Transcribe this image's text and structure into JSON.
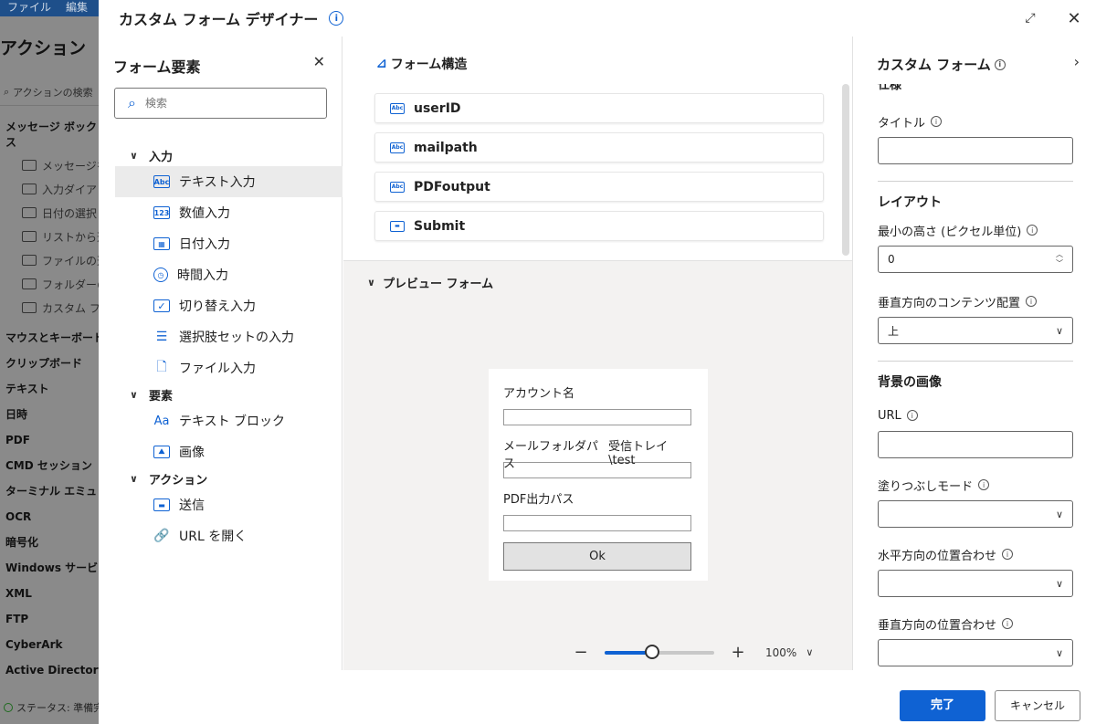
{
  "bg_app": {
    "menu": [
      "ファイル",
      "編集"
    ],
    "title": "アクション",
    "search_placeholder": "アクションの検索",
    "group": "メッセージ ボックス",
    "sub_items": [
      "メッセージを",
      "入力ダイア",
      "日付の選択",
      "リストから選",
      "ファイルの選",
      "フォルダーの",
      "カスタム フォ"
    ],
    "categories": [
      "マウスとキーボード",
      "クリップボード",
      "テキスト",
      "日時",
      "PDF",
      "CMD セッション",
      "ターミナル エミュレーシ",
      "OCR",
      "暗号化",
      "Windows サービス",
      "XML",
      "FTP",
      "CyberArk",
      "Active Directory"
    ],
    "status": "ステータス: 準備完了"
  },
  "dialog": {
    "title": "カスタム フォーム デザイナー",
    "expand_icon": "expand-icon",
    "close_icon": "close-icon"
  },
  "left_pane": {
    "title": "フォーム要素",
    "search_placeholder": "検索",
    "groups": [
      {
        "label": "入力",
        "items": [
          "テキスト入力",
          "数値入力",
          "日付入力",
          "時間入力",
          "切り替え入力",
          "選択肢セットの入力",
          "ファイル入力"
        ]
      },
      {
        "label": "要素",
        "items": [
          "テキスト ブロック",
          "画像"
        ]
      },
      {
        "label": "アクション",
        "items": [
          "送信",
          "URL を開く"
        ]
      }
    ],
    "selected": "テキスト入力"
  },
  "structure": {
    "title": "フォーム構造",
    "rows": [
      "userID",
      "mailpath",
      "PDFoutput",
      "Submit"
    ]
  },
  "preview": {
    "title": "プレビュー フォーム",
    "fields": [
      {
        "label": "アカウント名",
        "extra": ""
      },
      {
        "label": "メールフォルダパス",
        "extra": "受信トレイ\\test"
      },
      {
        "label": "PDF出力パス",
        "extra": ""
      }
    ],
    "button": "Ok",
    "zoom": "100%",
    "zoom_fraction": 0.43
  },
  "right_pane": {
    "title": "カスタム フォーム",
    "cut_section": "仕様",
    "title_label": "タイトル",
    "layout_section": "レイアウト",
    "min_height_label": "最小の高さ (ピクセル単位)",
    "min_height_value": "0",
    "vertical_content_label": "垂直方向のコンテンツ配置",
    "vertical_content_value": "上",
    "bg_section": "背景の画像",
    "url_label": "URL",
    "fill_mode_label": "塗りつぶしモード",
    "h_align_label": "水平方向の位置合わせ",
    "v_align_label": "垂直方向の位置合わせ"
  },
  "footer": {
    "done": "完了",
    "cancel": "キャンセル"
  },
  "colors": {
    "accent": "#0f62d3",
    "selected_bg": "#ebebeb"
  }
}
